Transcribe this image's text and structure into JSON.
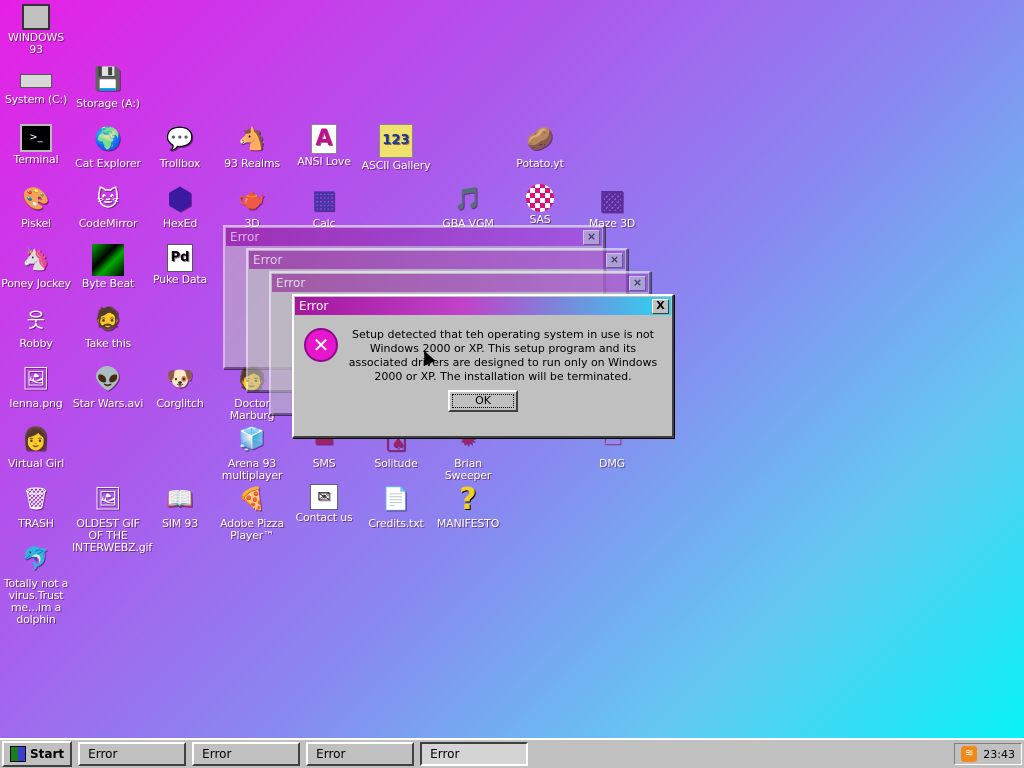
{
  "desktop": {
    "icons": [
      {
        "label": "WINDOWS 93",
        "icon": "computer-icon",
        "glyph": "🖥"
      },
      {
        "label": "System (C:)",
        "icon": "hard-drive-icon",
        "glyph": ""
      },
      {
        "label": "Storage (A:)",
        "icon": "floppy-drive-icon",
        "glyph": "💾"
      },
      {
        "label": "Terminal",
        "icon": "terminal-icon",
        "glyph": ">_"
      },
      {
        "label": "Cat Explorer",
        "icon": "globe-icon",
        "glyph": "🌍"
      },
      {
        "label": "Trollbox",
        "icon": "chat-icon",
        "glyph": "💬"
      },
      {
        "label": "93 Realms",
        "icon": "knight-icon",
        "glyph": "🐴"
      },
      {
        "label": "ANSI Love",
        "icon": "ansi-icon",
        "glyph": "A"
      },
      {
        "label": "ASCII Gallery",
        "icon": "ascii-icon",
        "glyph": "123"
      },
      {
        "label": "Potato.yt",
        "icon": "potato-icon",
        "glyph": "🥔"
      },
      {
        "label": "Piskel",
        "icon": "palette-icon",
        "glyph": "🎨"
      },
      {
        "label": "CodeMirror",
        "icon": "codemirror-icon",
        "glyph": "🐱"
      },
      {
        "label": "HexEd",
        "icon": "cube-icon",
        "glyph": "⬢"
      },
      {
        "label": "3D",
        "icon": "teapot-icon",
        "glyph": "🫖"
      },
      {
        "label": "Calc",
        "icon": "calculator-icon",
        "glyph": "▦"
      },
      {
        "label": "GBA VGM",
        "icon": "music-file-icon",
        "glyph": "🎵"
      },
      {
        "label": "SAS",
        "icon": "ball-icon",
        "glyph": "⚽"
      },
      {
        "label": "Maze 3D",
        "icon": "maze-icon",
        "glyph": "▩"
      },
      {
        "label": "Poney Jockey",
        "icon": "pony-icon",
        "glyph": "🦄"
      },
      {
        "label": "Byte Beat",
        "icon": "bytebeat-icon",
        "glyph": "▨"
      },
      {
        "label": "Puke Data",
        "icon": "pd-icon",
        "glyph": "Pd"
      },
      {
        "label": "Robby",
        "icon": "robot-icon",
        "glyph": "웃"
      },
      {
        "label": "Take this",
        "icon": "sprite-icon",
        "glyph": "🧔"
      },
      {
        "label": "lenna.png",
        "icon": "image-icon",
        "glyph": "🖼"
      },
      {
        "label": "Star Wars.avi",
        "icon": "yoda-icon",
        "glyph": "👽"
      },
      {
        "label": "Corglitch",
        "icon": "dog-icon",
        "glyph": "🐶"
      },
      {
        "label": "Doctor Marburg",
        "icon": "doctor-icon",
        "glyph": "🧑"
      },
      {
        "label": "Virtual Girl",
        "icon": "face-icon",
        "glyph": "👩"
      },
      {
        "label": "Arena 93 multiplayer",
        "icon": "arena-cube-icon",
        "glyph": "🧊"
      },
      {
        "label": "SMS",
        "icon": "sms-icon",
        "glyph": "▬"
      },
      {
        "label": "Solitude",
        "icon": "cards-icon",
        "glyph": "🂡"
      },
      {
        "label": "Brian Sweeper",
        "icon": "mine-icon",
        "glyph": "✹"
      },
      {
        "label": "DMG",
        "icon": "dmg-icon",
        "glyph": "▭"
      },
      {
        "label": "TRASH",
        "icon": "trash-icon",
        "glyph": "🗑"
      },
      {
        "label": "OLDEST GIF OF THE INTERWEBZ.gif",
        "icon": "gif-icon",
        "glyph": "🖼"
      },
      {
        "label": "SIM 93",
        "icon": "book-icon",
        "glyph": "📖"
      },
      {
        "label": "Adobe Pizza Player™",
        "icon": "pizza-icon",
        "glyph": "🍕"
      },
      {
        "label": "Contact us",
        "icon": "contact-icon",
        "glyph": "✉"
      },
      {
        "label": "Credits.txt",
        "icon": "text-file-icon",
        "glyph": "📄"
      },
      {
        "label": "MANIFESTO",
        "icon": "question-icon",
        "glyph": "?"
      },
      {
        "label": "Totally not a virus.Trust me...im a dolphin",
        "icon": "dolphin-icon",
        "glyph": "🐬"
      }
    ]
  },
  "windows": [
    {
      "title": "Error"
    },
    {
      "title": "Error"
    },
    {
      "title": "Error"
    },
    {
      "title": "Error",
      "close_label": "X",
      "icon_glyph": "✕",
      "message": "Setup detected that teh operating system in use is not Windows 2000 or XP. This setup program and its associated drivers are designed to run only on Windows 2000 or XP. The installation will be terminated.",
      "ok_label": "OK"
    }
  ],
  "taskbar": {
    "start_label": "Start",
    "tasks": [
      "Error",
      "Error",
      "Error",
      "Error"
    ],
    "clock": "23:43"
  }
}
